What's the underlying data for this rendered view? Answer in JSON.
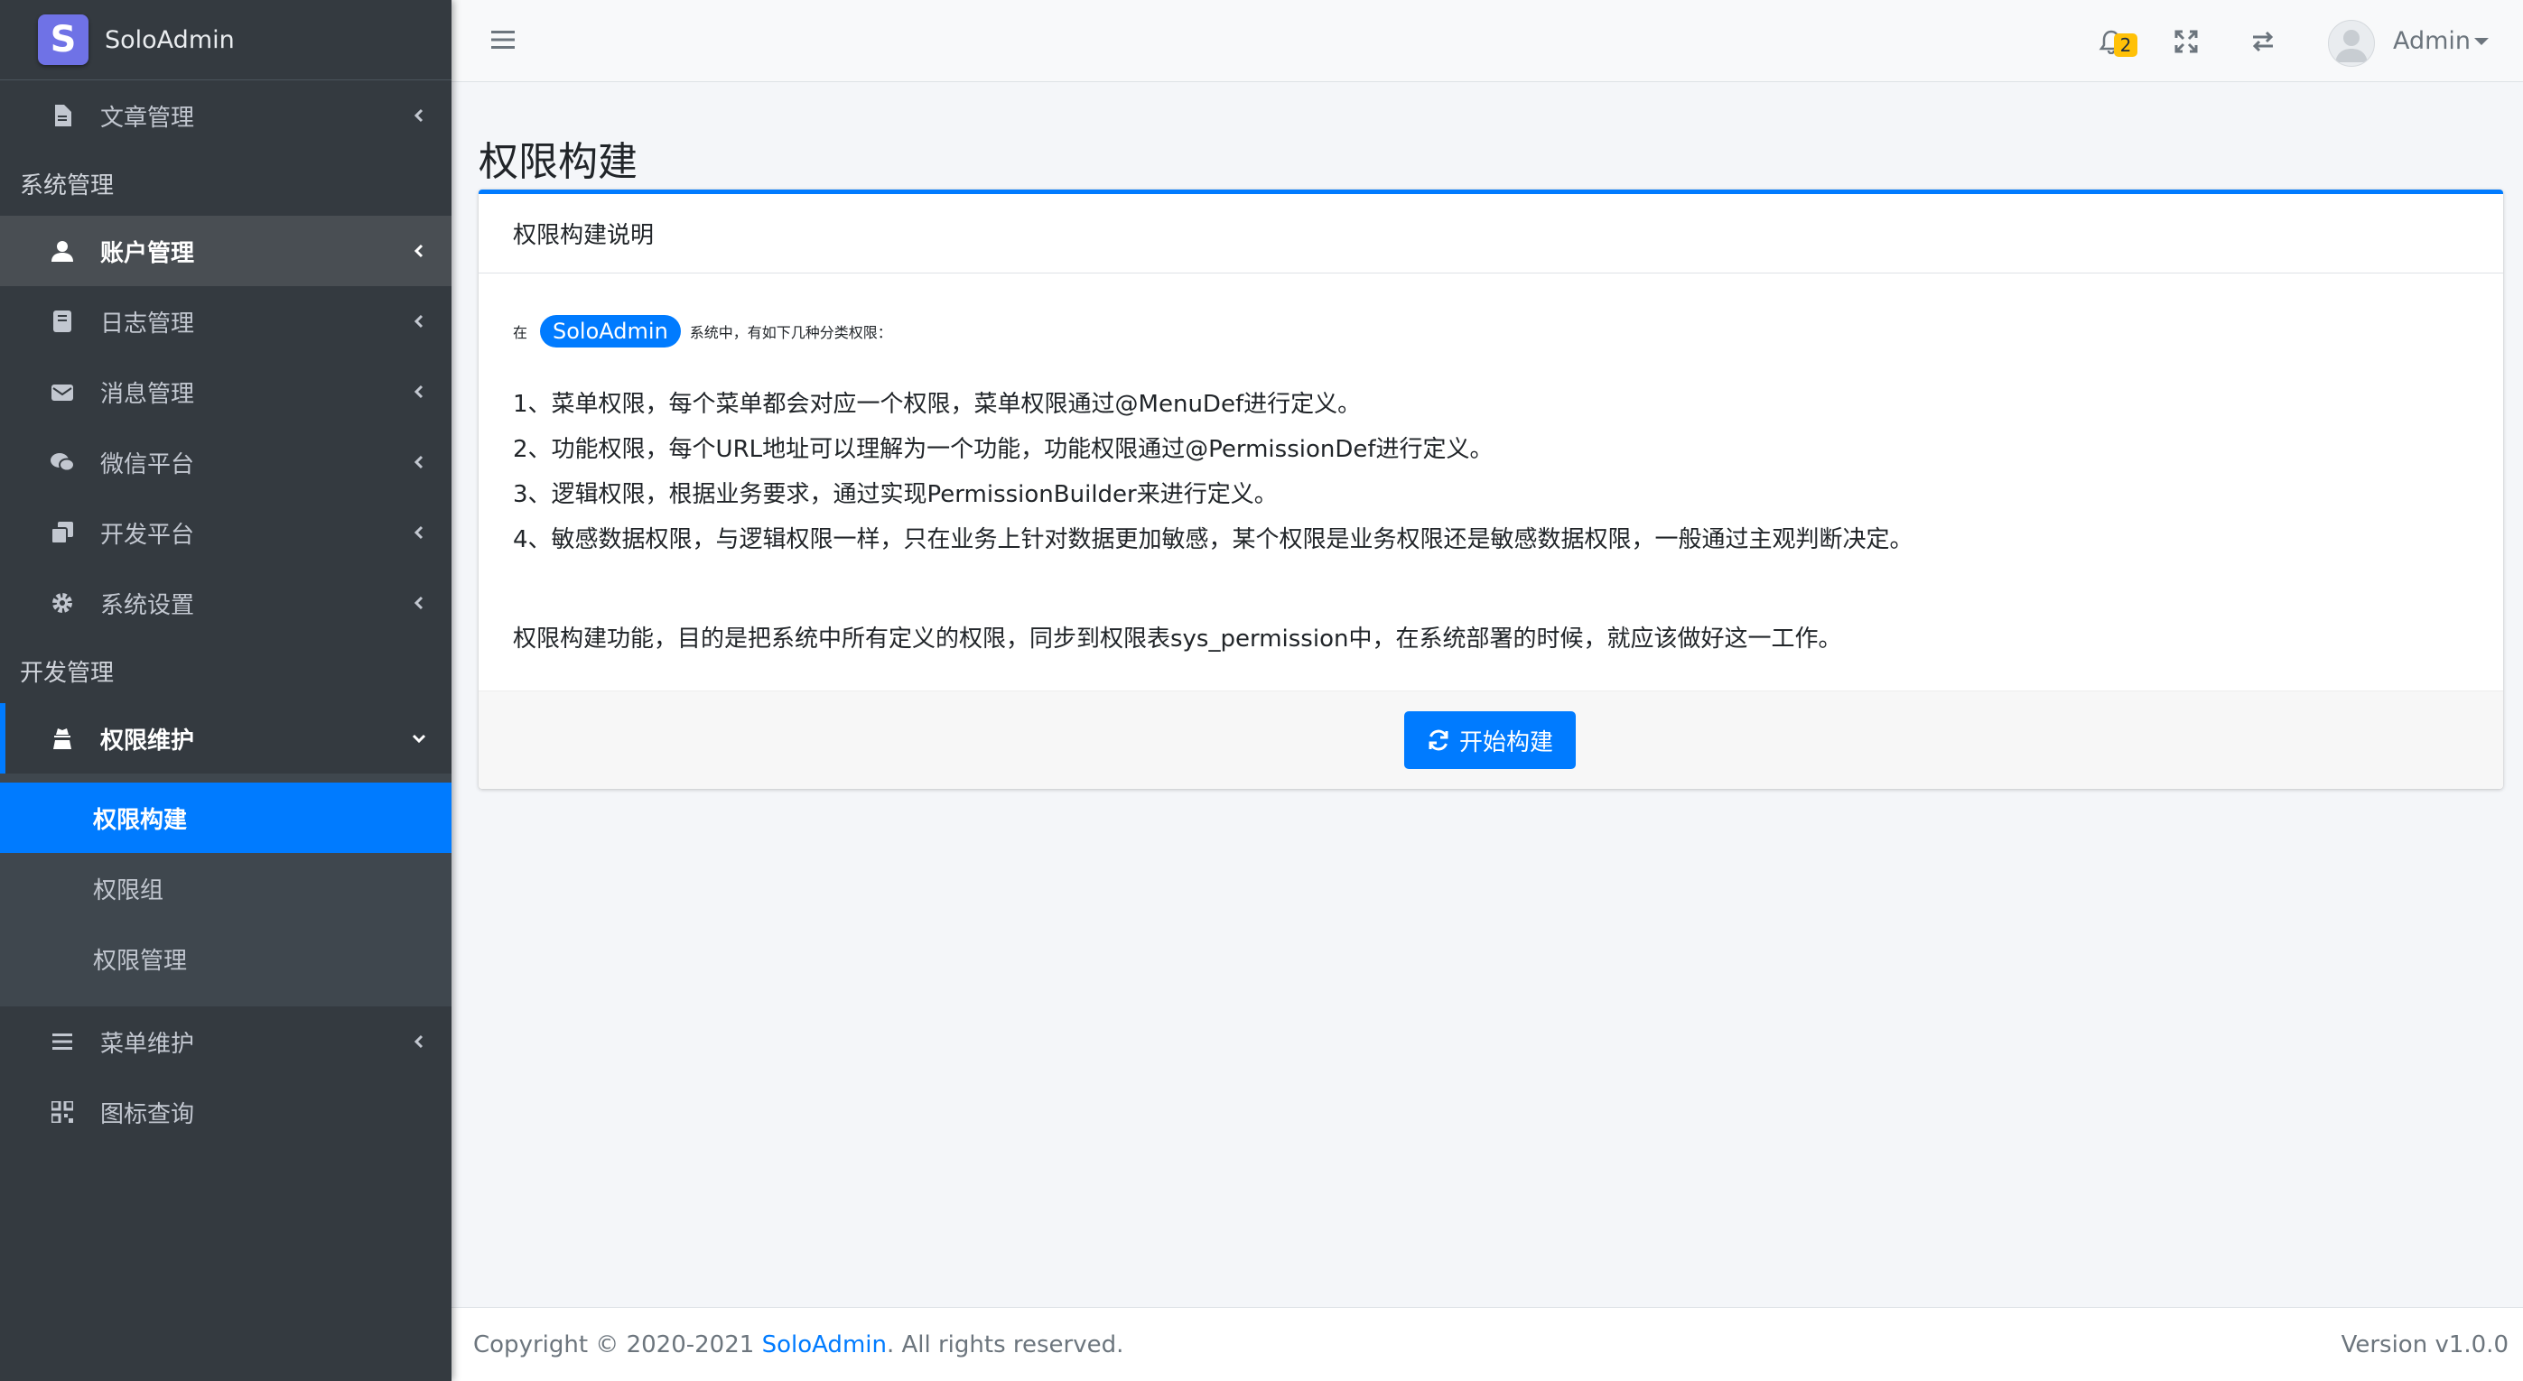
{
  "brand": {
    "logo_letter": "S",
    "name": "SoloAdmin",
    "logo_color": "#6f72e6"
  },
  "sidebar": {
    "item_article": "文章管理",
    "header_system": "系统管理",
    "item_account": "账户管理",
    "item_log": "日志管理",
    "item_message": "消息管理",
    "item_wechat": "微信平台",
    "item_devplatform": "开发平台",
    "item_settings": "系统设置",
    "header_dev": "开发管理",
    "item_permission": "权限维护",
    "sub_build": "权限构建",
    "sub_group": "权限组",
    "sub_manage": "权限管理",
    "item_menu": "菜单维护",
    "item_icon": "图标查询"
  },
  "topbar": {
    "notification_count": "2",
    "user_name": "Admin"
  },
  "page": {
    "title": "权限构建"
  },
  "card": {
    "header": "权限构建说明",
    "intro_prefix": "在",
    "intro_badge": "SoloAdmin",
    "intro_suffix": "系统中，有如下几种分类权限：",
    "rules": [
      "1、菜单权限，每个菜单都会对应一个权限，菜单权限通过@MenuDef进行定义。",
      "2、功能权限，每个URL地址可以理解为一个功能，功能权限通过@PermissionDef进行定义。",
      "3、逻辑权限，根据业务要求，通过实现PermissionBuilder来进行定义。",
      "4、敏感数据权限，与逻辑权限一样，只在业务上针对数据更加敏感，某个权限是业务权限还是敏感数据权限，一般通过主观判断决定。"
    ],
    "summary": "权限构建功能，目的是把系统中所有定义的权限，同步到权限表sys_permission中，在系统部署的时候，就应该做好这一工作。",
    "button": "开始构建"
  },
  "footer": {
    "copyright_prefix": "Copyright © 2020-2021",
    "copyright_link": "SoloAdmin",
    "copyright_suffix": ". All rights reserved.",
    "version": "Version v1.0.0"
  },
  "colors": {
    "primary": "#007bff",
    "sidebar_bg": "#343a40",
    "badge_warning": "#ffc107"
  }
}
